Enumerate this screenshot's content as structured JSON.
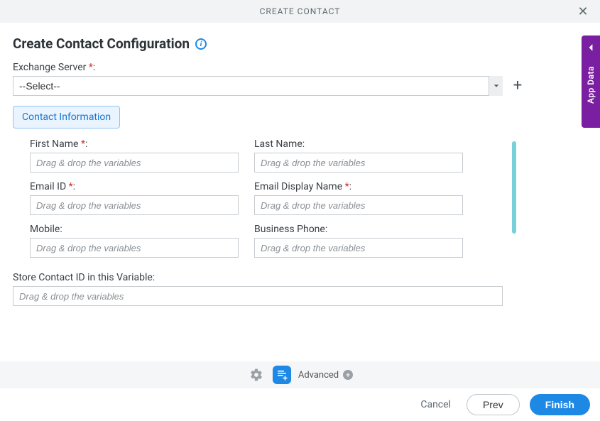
{
  "titlebar": {
    "title": "CREATE CONTACT"
  },
  "heading": "Create Contact Configuration",
  "exchange": {
    "label": "Exchange Server ",
    "required": "*",
    "selected": "--Select--"
  },
  "tab_label": "Contact Information",
  "placeholder": "Drag & drop the variables",
  "fields": {
    "left": [
      {
        "label": "First Name ",
        "required": "*"
      },
      {
        "label": "Email ID ",
        "required": "*"
      },
      {
        "label": "Mobile",
        "required": ""
      }
    ],
    "right": [
      {
        "label": "Last Name",
        "required": ""
      },
      {
        "label": "Email Display Name ",
        "required": "*"
      },
      {
        "label": "Business Phone",
        "required": ""
      }
    ]
  },
  "store_label": "Store Contact ID in this Variable:",
  "bottombar": {
    "advanced": "Advanced"
  },
  "footer": {
    "cancel": "Cancel",
    "prev": "Prev",
    "finish": "Finish"
  },
  "side": {
    "label": "App Data"
  }
}
